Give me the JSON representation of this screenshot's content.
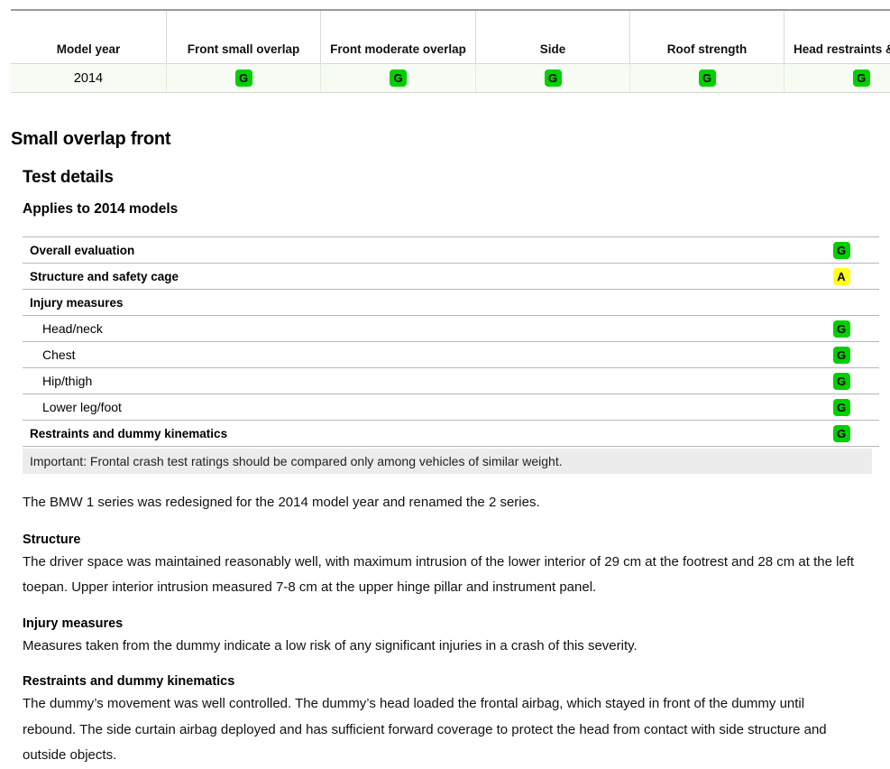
{
  "summary_table": {
    "columns": [
      "Model year",
      "Front small overlap",
      "Front moderate overlap",
      "Side",
      "Roof strength",
      "Head restraints & seats"
    ],
    "rows": [
      {
        "model_year": "2014",
        "front_small_overlap": "G",
        "front_moderate_overlap": "G",
        "side": "G",
        "roof_strength": "G",
        "head_restraints_seats": "G"
      }
    ]
  },
  "section": {
    "title": "Small overlap front",
    "subtitle": "Test details",
    "applies_to": "Applies to 2014 models"
  },
  "test_details": {
    "rows": [
      {
        "label": "Overall evaluation",
        "rating": "G",
        "bold": true,
        "indent": false
      },
      {
        "label": "Structure and safety cage",
        "rating": "A",
        "bold": true,
        "indent": false
      },
      {
        "label": "Injury measures",
        "rating": "",
        "bold": true,
        "indent": false
      },
      {
        "label": "Head/neck",
        "rating": "G",
        "bold": false,
        "indent": true
      },
      {
        "label": "Chest",
        "rating": "G",
        "bold": false,
        "indent": true
      },
      {
        "label": "Hip/thigh",
        "rating": "G",
        "bold": false,
        "indent": true
      },
      {
        "label": "Lower leg/foot",
        "rating": "G",
        "bold": false,
        "indent": true
      },
      {
        "label": "Restraints and dummy kinematics",
        "rating": "G",
        "bold": true,
        "indent": false
      }
    ]
  },
  "notice": {
    "text": "Important: Frontal crash test ratings should be compared only among vehicles of similar weight."
  },
  "body": {
    "lead": "The BMW 1 series was redesigned for the 2014 model year and renamed the 2 series.",
    "blocks": [
      {
        "heading": "Structure",
        "text": "The driver space was maintained reasonably well, with maximum intrusion of the lower interior of 29 cm at the footrest and 28 cm at the left toepan. Upper interior intrusion measured 7-8 cm at the upper hinge pillar and instrument panel."
      },
      {
        "heading": "Injury measures",
        "text": "Measures taken from the dummy indicate a low risk of any significant injuries in a crash of this severity."
      },
      {
        "heading": "Restraints and dummy kinematics",
        "text": "The dummy’s movement was well controlled. The dummy’s head loaded the frontal airbag, which stayed in front of the dummy until rebound. The side curtain airbag deployed and has sufficient forward coverage to protect the head from contact with side structure and outside objects."
      }
    ]
  },
  "rating_colors": {
    "good": "#00cf00",
    "acceptable": "#ffff1a",
    "marginal": "#ff9a00",
    "poor": "#ff0000"
  }
}
